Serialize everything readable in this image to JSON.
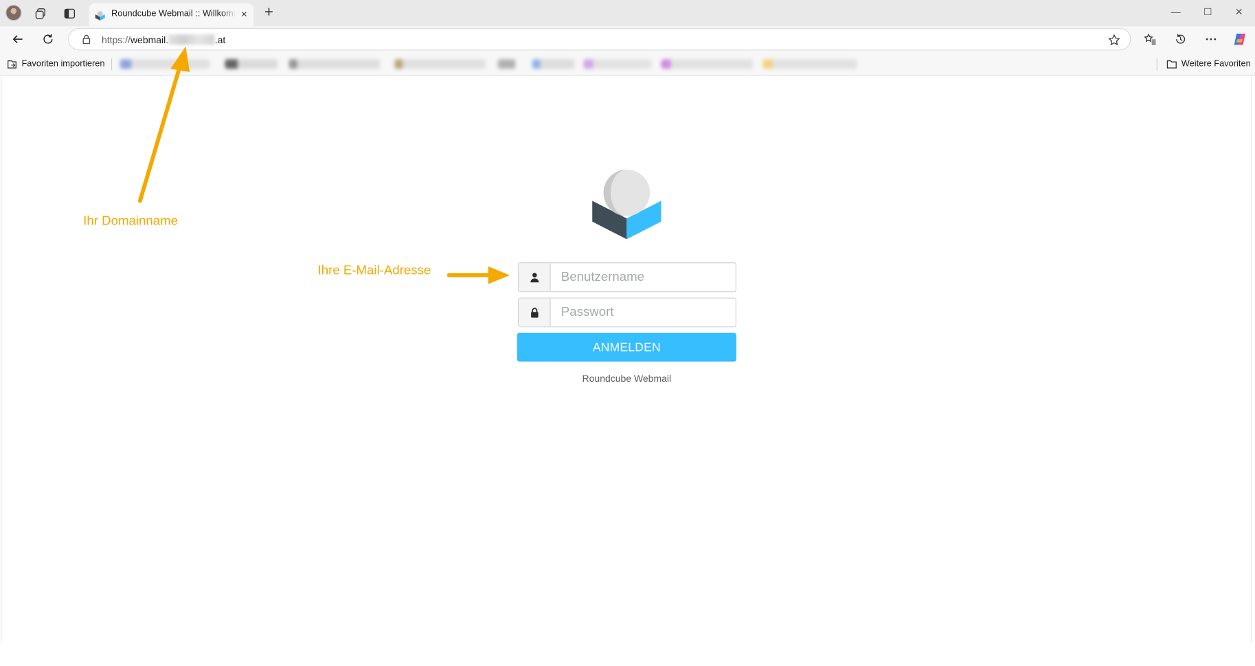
{
  "browser": {
    "tab_title": "Roundcube Webmail :: Willkommen bei Roundcube Webmail",
    "tab_close": "×",
    "new_tab": "+",
    "window_minimize": "—",
    "window_maximize": "☐",
    "window_close": "✕",
    "url_protocol": "https://",
    "url_host_visible": "webmail.",
    "url_tld": ".at",
    "favorites_import": "Favoriten importieren",
    "favorites_more": "Weitere Favoriten"
  },
  "login": {
    "username_placeholder": "Benutzername",
    "password_placeholder": "Passwort",
    "submit_label": "ANMELDEN",
    "footer": "Roundcube Webmail"
  },
  "annotations": {
    "domain_label": "Ihr Domainname",
    "email_label": "Ihre E-Mail-Adresse"
  },
  "colors": {
    "accent": "#37beff",
    "annotation": "#f5a800",
    "logo_dark": "#3f4d56",
    "logo_blue": "#37beff"
  },
  "icons": {
    "user": "user-icon",
    "lock": "lock-icon",
    "star": "star-icon"
  }
}
